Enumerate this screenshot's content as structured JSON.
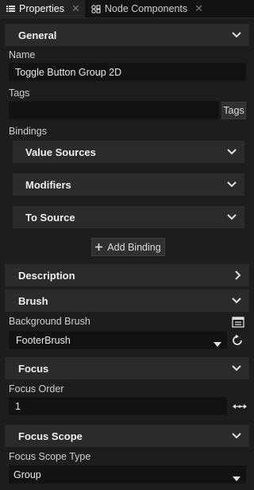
{
  "tabs": [
    {
      "label": "Properties",
      "icon": "list-icon"
    },
    {
      "label": "Node Components",
      "icon": "node-components-icon"
    }
  ],
  "sections": {
    "general": "General",
    "value_sources": "Value Sources",
    "modifiers": "Modifiers",
    "to_source": "To Source",
    "description": "Description",
    "brush": "Brush",
    "focus": "Focus",
    "focus_scope": "Focus Scope"
  },
  "fields": {
    "name_label": "Name",
    "name_value": "Toggle Button Group 2D",
    "tags_label": "Tags",
    "tags_value": "",
    "tags_button": "Tags",
    "bindings_label": "Bindings",
    "add_binding_button": "Add Binding",
    "background_brush_label": "Background Brush",
    "background_brush_value": "FooterBrush",
    "focus_order_label": "Focus Order",
    "focus_order_value": "1",
    "focus_scope_type_label": "Focus Scope Type",
    "focus_scope_type_value": "Group"
  },
  "colors": {
    "background": "#1d1d1d",
    "section_header": "#2b2b2b",
    "input": "#121212",
    "text": "#dcdcdc"
  }
}
